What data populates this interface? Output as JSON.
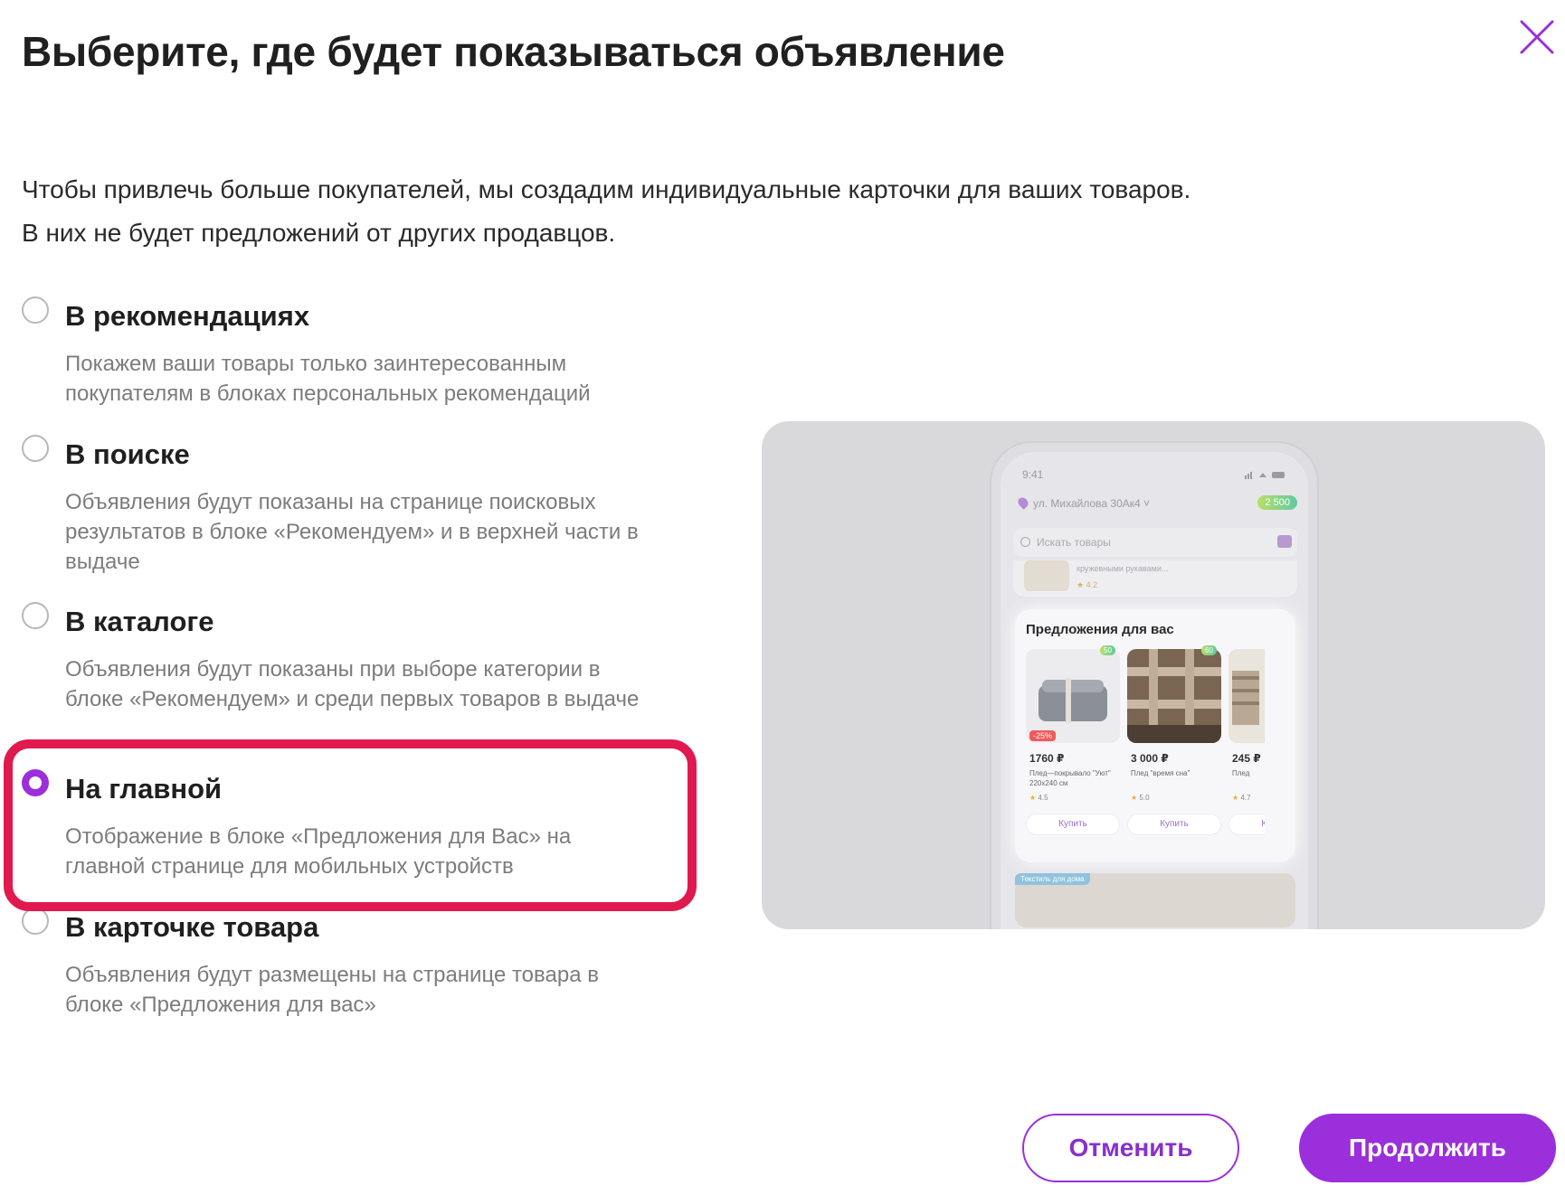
{
  "dialog": {
    "title": "Выберите, где будет показываться объявление",
    "intro_line1": "Чтобы привлечь больше покупателей, мы создадим индивидуальные карточки для ваших товаров.",
    "intro_line2": "В них не будет предложений от других продавцов."
  },
  "options": [
    {
      "title": "В рекомендациях",
      "desc": "Покажем ваши товары только заинтересованным покупателям в блоках персональных рекомендаций",
      "selected": false
    },
    {
      "title": "В поиске",
      "desc": "Объявления будут показаны на странице поисковых результатов в блоке «Рекомендуем» и в верхней части в выдаче",
      "selected": false
    },
    {
      "title": "В каталоге",
      "desc": "Объявления будут показаны при выборе категории в блоке «Рекомендуем» и среди первых товаров в выдаче",
      "selected": false
    },
    {
      "title": "На главной",
      "desc": "Отображение в блоке «Предложения для Вас» на главной странице для мобильных устройств",
      "selected": true
    },
    {
      "title": "В карточке товара",
      "desc": "Объявления будут размещены на странице товара в блоке «Предложения для вас»",
      "selected": false
    }
  ],
  "preview": {
    "time": "9:41",
    "address": "ул. Михайлова 30Ак4",
    "bonus": "2 500",
    "search_placeholder": "Искать товары",
    "strip_text": "кружевными рукавами...",
    "strip_rating": "4.2",
    "block_title": "Предложения для вас",
    "products": [
      {
        "price": "1760 ₽",
        "name": "Плед—покрывало \"Уют\" 220х240 см",
        "rating": "4.5",
        "discount": "-25%",
        "badge": "50",
        "buy": "Купить"
      },
      {
        "price": "3 000 ₽",
        "name": "Плед \"время сна\"",
        "rating": "5.0",
        "discount": "",
        "badge": "60",
        "buy": "Купить"
      },
      {
        "price": "245 ₽",
        "name": "Плед",
        "rating": "4.7",
        "discount": "",
        "badge": "",
        "buy": "Купить"
      }
    ],
    "bottom_tag": "Текстиль для дома"
  },
  "buttons": {
    "cancel": "Отменить",
    "continue": "Продолжить"
  },
  "colors": {
    "accent": "#9b2fdb",
    "highlight": "#e01a4f"
  }
}
